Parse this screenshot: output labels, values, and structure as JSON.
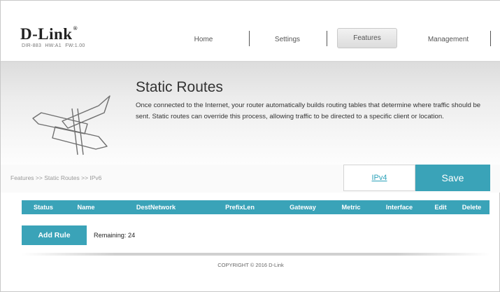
{
  "header": {
    "logo": "D-Link",
    "logo_reg": "®",
    "model_info": "DIR-883   HW:A1   FW:1.00",
    "tabs": [
      {
        "label": "Home"
      },
      {
        "label": "Settings"
      },
      {
        "label": "Features",
        "active": true
      },
      {
        "label": "Management"
      }
    ]
  },
  "banner": {
    "title": "Static Routes",
    "description": "Once connected to the Internet, your router automatically builds routing tables that determine where traffic should be sent. Static routes can override this process, allowing traffic to be directed to a specific client or location.",
    "icon": "signpost-icon"
  },
  "breadcrumb": "Features >> Static Routes >> IPv6",
  "actions": {
    "ipv4_label": "IPv4",
    "save_label": "Save"
  },
  "table": {
    "columns": [
      "Status",
      "Name",
      "DestNetwork",
      "PrefixLen",
      "Gateway",
      "Metric",
      "Interface",
      "Edit",
      "Delete"
    ],
    "rows": []
  },
  "add_rule_label": "Add Rule",
  "remaining_text": "Remaining: 24",
  "footer": {
    "copyright": "COPYRIGHT © 2016 D-Link"
  },
  "colors": {
    "accent": "#3aa3b8",
    "link": "#2aa1b9"
  }
}
